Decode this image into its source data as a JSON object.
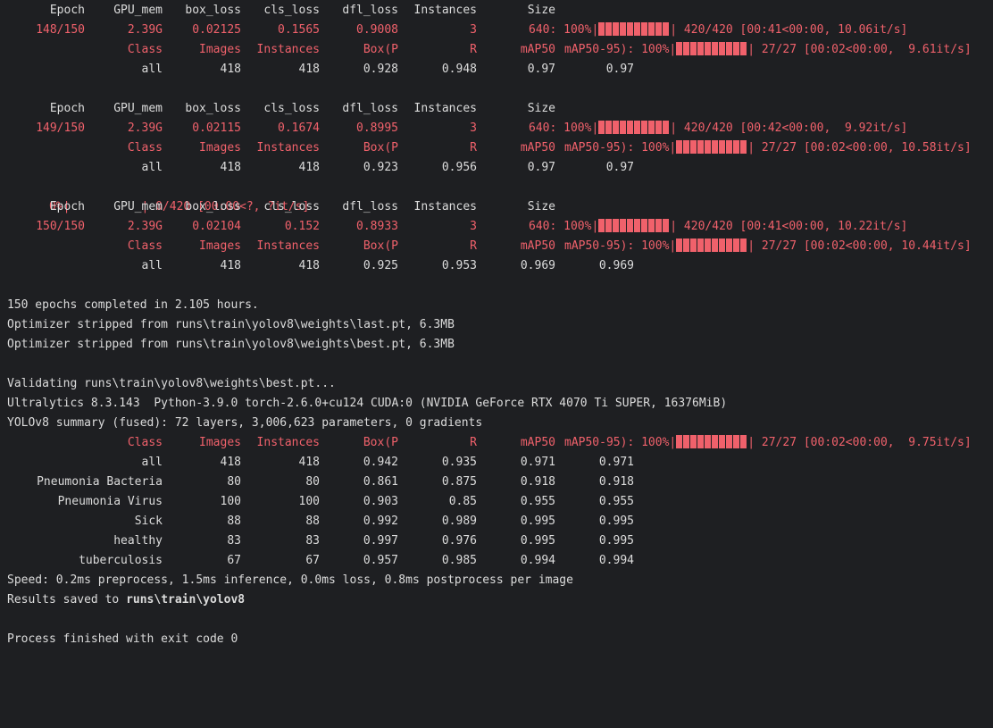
{
  "epochs": [
    {
      "header": {
        "epoch": "Epoch",
        "gpu_mem": "GPU_mem",
        "box_loss": "box_loss",
        "cls_loss": "cls_loss",
        "dfl_loss": "dfl_loss",
        "instances": "Instances",
        "size": "Size"
      },
      "train": {
        "epoch": "148/150",
        "gpu_mem": "2.39G",
        "box_loss": "0.02125",
        "cls_loss": "0.1565",
        "dfl_loss": "0.9008",
        "instances": "3",
        "progress_lead": "640: 100%|",
        "progress_tail": "| 420/420 [00:41<00:00, 10.06it/s]"
      },
      "val_header": {
        "cls": "Class",
        "images": "Images",
        "instances": "Instances",
        "box_p": "Box(P",
        "r": "R",
        "map50": "mAP50",
        "progress_lead": "mAP50-95): 100%|",
        "progress_tail": "| 27/27 [00:02<00:00,  9.61it/s]"
      },
      "val_all": {
        "cls": "all",
        "images": "418",
        "instances": "418",
        "p": "0.928",
        "r": "0.948",
        "map50": "0.97",
        "map5095": "0.97"
      }
    },
    {
      "header": {
        "epoch": "Epoch",
        "gpu_mem": "GPU_mem",
        "box_loss": "box_loss",
        "cls_loss": "cls_loss",
        "dfl_loss": "dfl_loss",
        "instances": "Instances",
        "size": "Size"
      },
      "train": {
        "epoch": "149/150",
        "gpu_mem": "2.39G",
        "box_loss": "0.02115",
        "cls_loss": "0.1674",
        "dfl_loss": "0.8995",
        "instances": "3",
        "progress_lead": "640: 100%|",
        "progress_tail": "| 420/420 [00:42<00:00,  9.92it/s]"
      },
      "val_header": {
        "cls": "Class",
        "images": "Images",
        "instances": "Instances",
        "box_p": "Box(P",
        "r": "R",
        "map50": "mAP50",
        "progress_lead": "mAP50-95): 100%|",
        "progress_tail": "| 27/27 [00:02<00:00, 10.58it/s]"
      },
      "val_all": {
        "cls": "all",
        "images": "418",
        "instances": "418",
        "p": "0.923",
        "r": "0.956",
        "map50": "0.97",
        "map5095": "0.97"
      }
    },
    {
      "header": {
        "epoch": "Epoch",
        "gpu_mem": "GPU_mem",
        "box_loss": "box_loss",
        "cls_loss": "cls_loss",
        "dfl_loss": "dfl_loss",
        "instances": "Instances",
        "size": "Size"
      },
      "train": {
        "epoch": "150/150",
        "gpu_mem": "2.39G",
        "box_loss": "0.02104",
        "cls_loss": "0.152",
        "dfl_loss": "0.8933",
        "instances": "3",
        "progress_lead": "640: 100%|",
        "progress_tail": "| 420/420 [00:41<00:00, 10.22it/s]"
      },
      "val_header": {
        "cls": "Class",
        "images": "Images",
        "instances": "Instances",
        "box_p": "Box(P",
        "r": "R",
        "map50": "mAP50",
        "progress_lead": "mAP50-95): 100%|",
        "progress_tail": "| 27/27 [00:02<00:00, 10.44it/s]"
      },
      "val_all": {
        "cls": "all",
        "images": "418",
        "instances": "418",
        "p": "0.925",
        "r": "0.953",
        "map50": "0.969",
        "map5095": "0.969"
      }
    }
  ],
  "zero_progress": {
    "lead": "  0%|",
    "tail": "| 0/420 [00:00<?, ?it/s]"
  },
  "summary": {
    "completed": "150 epochs completed in 2.105 hours.",
    "stripped_last": "Optimizer stripped from runs\\train\\yolov8\\weights\\last.pt, 6.3MB",
    "stripped_best": "Optimizer stripped from runs\\train\\yolov8\\weights\\best.pt, 6.3MB",
    "validating": "Validating runs\\train\\yolov8\\weights\\best.pt...",
    "env": "Ultralytics 8.3.143  Python-3.9.0 torch-2.6.0+cu124 CUDA:0 (NVIDIA GeForce RTX 4070 Ti SUPER, 16376MiB)",
    "model_summary": "YOLOv8 summary (fused): 72 layers, 3,006,623 parameters, 0 gradients"
  },
  "final_val": {
    "header": {
      "cls": "Class",
      "images": "Images",
      "instances": "Instances",
      "box_p": "Box(P",
      "r": "R",
      "map50": "mAP50",
      "progress_lead": "mAP50-95): 100%|",
      "progress_tail": "| 27/27 [00:02<00:00,  9.75it/s]"
    },
    "rows": [
      {
        "cls": "all",
        "images": "418",
        "instances": "418",
        "p": "0.942",
        "r": "0.935",
        "map50": "0.971",
        "map5095": "0.971"
      },
      {
        "cls": "Pneumonia Bacteria",
        "images": "80",
        "instances": "80",
        "p": "0.861",
        "r": "0.875",
        "map50": "0.918",
        "map5095": "0.918"
      },
      {
        "cls": "Pneumonia Virus",
        "images": "100",
        "instances": "100",
        "p": "0.903",
        "r": "0.85",
        "map50": "0.955",
        "map5095": "0.955"
      },
      {
        "cls": "Sick",
        "images": "88",
        "instances": "88",
        "p": "0.992",
        "r": "0.989",
        "map50": "0.995",
        "map5095": "0.995"
      },
      {
        "cls": "healthy",
        "images": "83",
        "instances": "83",
        "p": "0.997",
        "r": "0.976",
        "map50": "0.995",
        "map5095": "0.995"
      },
      {
        "cls": "tuberculosis",
        "images": "67",
        "instances": "67",
        "p": "0.957",
        "r": "0.985",
        "map50": "0.994",
        "map5095": "0.994"
      }
    ]
  },
  "speed": "Speed: 0.2ms preprocess, 1.5ms inference, 0.0ms loss, 0.8ms postprocess per image",
  "results": {
    "prefix": "Results saved to ",
    "path": "runs\\train\\yolov8"
  },
  "exit": "Process finished with exit code 0",
  "colors": {
    "background": "#1e1f22",
    "text": "#dcdcdc",
    "progress_red": "#f0616b"
  }
}
